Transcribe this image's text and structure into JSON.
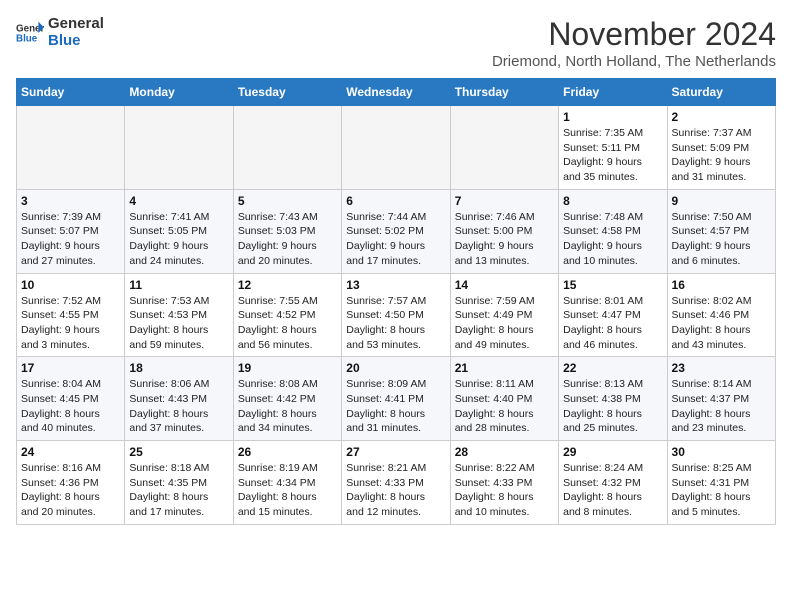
{
  "header": {
    "logo_line1": "General",
    "logo_line2": "Blue",
    "month": "November 2024",
    "location": "Driemond, North Holland, The Netherlands"
  },
  "weekdays": [
    "Sunday",
    "Monday",
    "Tuesday",
    "Wednesday",
    "Thursday",
    "Friday",
    "Saturday"
  ],
  "weeks": [
    [
      {
        "day": "",
        "info": ""
      },
      {
        "day": "",
        "info": ""
      },
      {
        "day": "",
        "info": ""
      },
      {
        "day": "",
        "info": ""
      },
      {
        "day": "",
        "info": ""
      },
      {
        "day": "1",
        "info": "Sunrise: 7:35 AM\nSunset: 5:11 PM\nDaylight: 9 hours\nand 35 minutes."
      },
      {
        "day": "2",
        "info": "Sunrise: 7:37 AM\nSunset: 5:09 PM\nDaylight: 9 hours\nand 31 minutes."
      }
    ],
    [
      {
        "day": "3",
        "info": "Sunrise: 7:39 AM\nSunset: 5:07 PM\nDaylight: 9 hours\nand 27 minutes."
      },
      {
        "day": "4",
        "info": "Sunrise: 7:41 AM\nSunset: 5:05 PM\nDaylight: 9 hours\nand 24 minutes."
      },
      {
        "day": "5",
        "info": "Sunrise: 7:43 AM\nSunset: 5:03 PM\nDaylight: 9 hours\nand 20 minutes."
      },
      {
        "day": "6",
        "info": "Sunrise: 7:44 AM\nSunset: 5:02 PM\nDaylight: 9 hours\nand 17 minutes."
      },
      {
        "day": "7",
        "info": "Sunrise: 7:46 AM\nSunset: 5:00 PM\nDaylight: 9 hours\nand 13 minutes."
      },
      {
        "day": "8",
        "info": "Sunrise: 7:48 AM\nSunset: 4:58 PM\nDaylight: 9 hours\nand 10 minutes."
      },
      {
        "day": "9",
        "info": "Sunrise: 7:50 AM\nSunset: 4:57 PM\nDaylight: 9 hours\nand 6 minutes."
      }
    ],
    [
      {
        "day": "10",
        "info": "Sunrise: 7:52 AM\nSunset: 4:55 PM\nDaylight: 9 hours\nand 3 minutes."
      },
      {
        "day": "11",
        "info": "Sunrise: 7:53 AM\nSunset: 4:53 PM\nDaylight: 8 hours\nand 59 minutes."
      },
      {
        "day": "12",
        "info": "Sunrise: 7:55 AM\nSunset: 4:52 PM\nDaylight: 8 hours\nand 56 minutes."
      },
      {
        "day": "13",
        "info": "Sunrise: 7:57 AM\nSunset: 4:50 PM\nDaylight: 8 hours\nand 53 minutes."
      },
      {
        "day": "14",
        "info": "Sunrise: 7:59 AM\nSunset: 4:49 PM\nDaylight: 8 hours\nand 49 minutes."
      },
      {
        "day": "15",
        "info": "Sunrise: 8:01 AM\nSunset: 4:47 PM\nDaylight: 8 hours\nand 46 minutes."
      },
      {
        "day": "16",
        "info": "Sunrise: 8:02 AM\nSunset: 4:46 PM\nDaylight: 8 hours\nand 43 minutes."
      }
    ],
    [
      {
        "day": "17",
        "info": "Sunrise: 8:04 AM\nSunset: 4:45 PM\nDaylight: 8 hours\nand 40 minutes."
      },
      {
        "day": "18",
        "info": "Sunrise: 8:06 AM\nSunset: 4:43 PM\nDaylight: 8 hours\nand 37 minutes."
      },
      {
        "day": "19",
        "info": "Sunrise: 8:08 AM\nSunset: 4:42 PM\nDaylight: 8 hours\nand 34 minutes."
      },
      {
        "day": "20",
        "info": "Sunrise: 8:09 AM\nSunset: 4:41 PM\nDaylight: 8 hours\nand 31 minutes."
      },
      {
        "day": "21",
        "info": "Sunrise: 8:11 AM\nSunset: 4:40 PM\nDaylight: 8 hours\nand 28 minutes."
      },
      {
        "day": "22",
        "info": "Sunrise: 8:13 AM\nSunset: 4:38 PM\nDaylight: 8 hours\nand 25 minutes."
      },
      {
        "day": "23",
        "info": "Sunrise: 8:14 AM\nSunset: 4:37 PM\nDaylight: 8 hours\nand 23 minutes."
      }
    ],
    [
      {
        "day": "24",
        "info": "Sunrise: 8:16 AM\nSunset: 4:36 PM\nDaylight: 8 hours\nand 20 minutes."
      },
      {
        "day": "25",
        "info": "Sunrise: 8:18 AM\nSunset: 4:35 PM\nDaylight: 8 hours\nand 17 minutes."
      },
      {
        "day": "26",
        "info": "Sunrise: 8:19 AM\nSunset: 4:34 PM\nDaylight: 8 hours\nand 15 minutes."
      },
      {
        "day": "27",
        "info": "Sunrise: 8:21 AM\nSunset: 4:33 PM\nDaylight: 8 hours\nand 12 minutes."
      },
      {
        "day": "28",
        "info": "Sunrise: 8:22 AM\nSunset: 4:33 PM\nDaylight: 8 hours\nand 10 minutes."
      },
      {
        "day": "29",
        "info": "Sunrise: 8:24 AM\nSunset: 4:32 PM\nDaylight: 8 hours\nand 8 minutes."
      },
      {
        "day": "30",
        "info": "Sunrise: 8:25 AM\nSunset: 4:31 PM\nDaylight: 8 hours\nand 5 minutes."
      }
    ]
  ]
}
